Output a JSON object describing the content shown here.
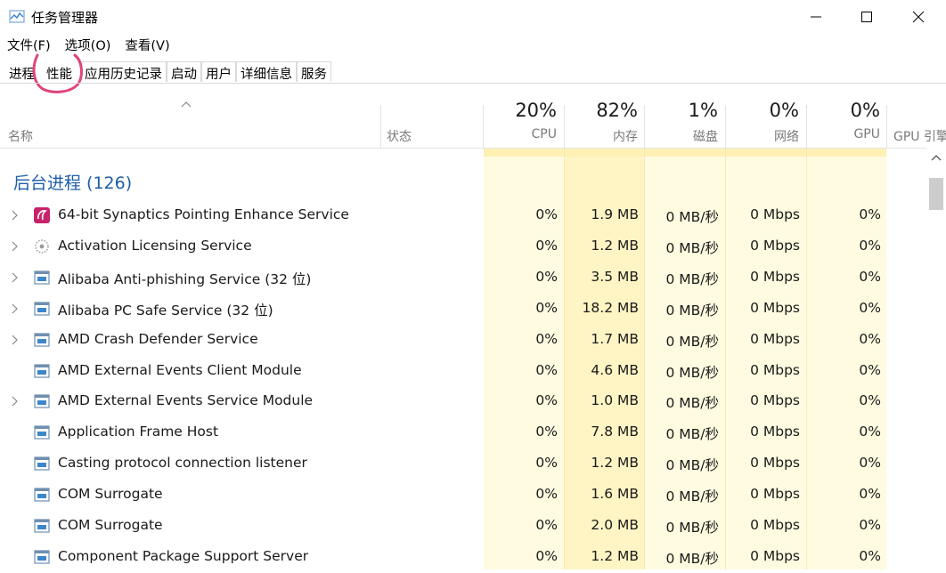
{
  "window": {
    "title": "任务管理器",
    "icon": "task-manager-icon"
  },
  "menu": [
    "文件(F)",
    "选项(O)",
    "查看(V)"
  ],
  "tabs": [
    {
      "label": "进程",
      "selected": true
    },
    {
      "label": "性能",
      "selected": false,
      "circled": true
    },
    {
      "label": "应用历史记录",
      "selected": false
    },
    {
      "label": "启动",
      "selected": false
    },
    {
      "label": "用户",
      "selected": false
    },
    {
      "label": "详细信息",
      "selected": false
    },
    {
      "label": "服务",
      "selected": false
    }
  ],
  "columns": {
    "name": "名称",
    "status": "状态",
    "cpu": {
      "pct": "20%",
      "label": "CPU"
    },
    "memory": {
      "pct": "82%",
      "label": "内存"
    },
    "disk": {
      "pct": "1%",
      "label": "磁盘"
    },
    "network": {
      "pct": "0%",
      "label": "网络"
    },
    "gpu": {
      "pct": "0%",
      "label": "GPU"
    },
    "gpu_engine": "GPU 引擎"
  },
  "group": {
    "label": "后台进程 (126)"
  },
  "processes": [
    {
      "name": "64-bit Synaptics Pointing Enhance Service",
      "icon": "synaptics-icon",
      "expandable": true,
      "cpu": "0%",
      "memory": "1.9 MB",
      "disk": "0 MB/秒",
      "network": "0 Mbps",
      "gpu": "0%"
    },
    {
      "name": "Activation Licensing Service",
      "icon": "gear-dots-icon",
      "expandable": true,
      "cpu": "0%",
      "memory": "1.2 MB",
      "disk": "0 MB/秒",
      "network": "0 Mbps",
      "gpu": "0%"
    },
    {
      "name": "Alibaba Anti-phishing Service (32 位)",
      "icon": "window-app-icon",
      "expandable": true,
      "cpu": "0%",
      "memory": "3.5 MB",
      "disk": "0 MB/秒",
      "network": "0 Mbps",
      "gpu": "0%"
    },
    {
      "name": "Alibaba PC Safe Service (32 位)",
      "icon": "window-app-icon",
      "expandable": true,
      "cpu": "0%",
      "memory": "18.2 MB",
      "disk": "0 MB/秒",
      "network": "0 Mbps",
      "gpu": "0%"
    },
    {
      "name": "AMD Crash Defender Service",
      "icon": "window-app-icon",
      "expandable": true,
      "cpu": "0%",
      "memory": "1.7 MB",
      "disk": "0 MB/秒",
      "network": "0 Mbps",
      "gpu": "0%"
    },
    {
      "name": "AMD External Events Client Module",
      "icon": "window-app-icon",
      "expandable": false,
      "cpu": "0%",
      "memory": "4.6 MB",
      "disk": "0 MB/秒",
      "network": "0 Mbps",
      "gpu": "0%"
    },
    {
      "name": "AMD External Events Service Module",
      "icon": "window-app-icon",
      "expandable": true,
      "cpu": "0%",
      "memory": "1.0 MB",
      "disk": "0 MB/秒",
      "network": "0 Mbps",
      "gpu": "0%"
    },
    {
      "name": "Application Frame Host",
      "icon": "window-app-icon",
      "expandable": false,
      "cpu": "0%",
      "memory": "7.8 MB",
      "disk": "0 MB/秒",
      "network": "0 Mbps",
      "gpu": "0%"
    },
    {
      "name": "Casting protocol connection listener",
      "icon": "window-app-icon",
      "expandable": false,
      "cpu": "0%",
      "memory": "1.2 MB",
      "disk": "0 MB/秒",
      "network": "0 Mbps",
      "gpu": "0%"
    },
    {
      "name": "COM Surrogate",
      "icon": "window-app-icon",
      "expandable": false,
      "cpu": "0%",
      "memory": "1.6 MB",
      "disk": "0 MB/秒",
      "network": "0 Mbps",
      "gpu": "0%"
    },
    {
      "name": "COM Surrogate",
      "icon": "window-app-icon",
      "expandable": false,
      "cpu": "0%",
      "memory": "2.0 MB",
      "disk": "0 MB/秒",
      "network": "0 Mbps",
      "gpu": "0%"
    },
    {
      "name": "Component Package Support Server",
      "icon": "window-app-icon",
      "expandable": false,
      "cpu": "0%",
      "memory": "1.2 MB",
      "disk": "0 MB/秒",
      "network": "0 Mbps",
      "gpu": "0%"
    }
  ],
  "colors": {
    "group_text": "#1e5ea8",
    "heat_light": "#fffbe0",
    "heat_memory": "#fff4c4",
    "annotation_circle": "#e0447c"
  }
}
